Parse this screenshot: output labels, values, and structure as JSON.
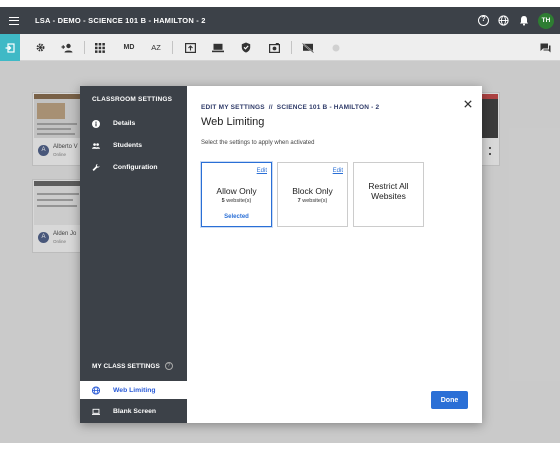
{
  "app": {
    "title": "LSA - DEMO - SCIENCE 101 B - HAMILTON - 2",
    "user_initials": "TH"
  },
  "toolbar": {
    "md_label": "MD",
    "sort_label": "AZ"
  },
  "cards": [
    {
      "initial": "A",
      "name": "Alberto V",
      "status": "Online"
    },
    {
      "initial": "A",
      "name": "Alden Jo",
      "status": "Online"
    }
  ],
  "sidebar": {
    "heading": "CLASSROOM SETTINGS",
    "items": [
      {
        "label": "Details",
        "icon": "info-icon"
      },
      {
        "label": "Students",
        "icon": "people-icon"
      },
      {
        "label": "Configuration",
        "icon": "wrench-icon"
      }
    ],
    "my_heading": "MY CLASS SETTINGS",
    "my_items": [
      {
        "label": "Web Limiting",
        "icon": "globe-icon",
        "active": true
      },
      {
        "label": "Blank Screen",
        "icon": "laptop-icon",
        "active": false
      }
    ]
  },
  "modal": {
    "breadcrumb": "EDIT MY SETTINGS  //  SCIENCE 101 B - HAMILTON - 2",
    "title": "Web Limiting",
    "subtitle": "Select the settings to apply when activated",
    "done_label": "Done",
    "options": [
      {
        "title": "Allow Only",
        "count": "5",
        "count_suffix": " website(s)",
        "edit": "Edit",
        "selected_label": "Selected"
      },
      {
        "title": "Block Only",
        "count": "7",
        "count_suffix": " website(s)",
        "edit": "Edit"
      },
      {
        "title_line1": "Restrict All",
        "title_line2": "Websites"
      }
    ]
  },
  "colors": {
    "accent": "#2a6fd6",
    "sidebar": "#3c4148",
    "exit_button": "#3fb9c6",
    "avatar": "#2e7d32"
  }
}
